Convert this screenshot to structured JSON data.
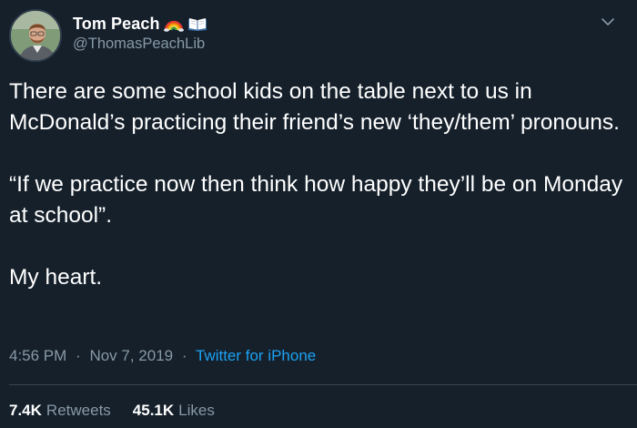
{
  "author": {
    "display_name": "Tom Peach",
    "handle": "@ThomasPeachLib",
    "name_emojis": [
      "rainbow-icon",
      "open-book-icon"
    ]
  },
  "tweet": {
    "paragraphs": [
      "There are some school kids on the table next to us in McDonald’s practicing their friend’s new ‘they/them’ pronouns.",
      "“If we practice now then think how happy they’ll be on Monday at school”.",
      "My heart."
    ]
  },
  "meta": {
    "time": "4:56 PM",
    "separator": "·",
    "date": "Nov 7, 2019",
    "source": "Twitter for iPhone"
  },
  "stats": {
    "retweets_count": "7.4K",
    "retweets_label": "Retweets",
    "likes_count": "45.1K",
    "likes_label": "Likes"
  },
  "colors": {
    "background": "#15202b",
    "secondary_text": "#8899a6",
    "link": "#1da1f2",
    "divider": "#38444d"
  }
}
